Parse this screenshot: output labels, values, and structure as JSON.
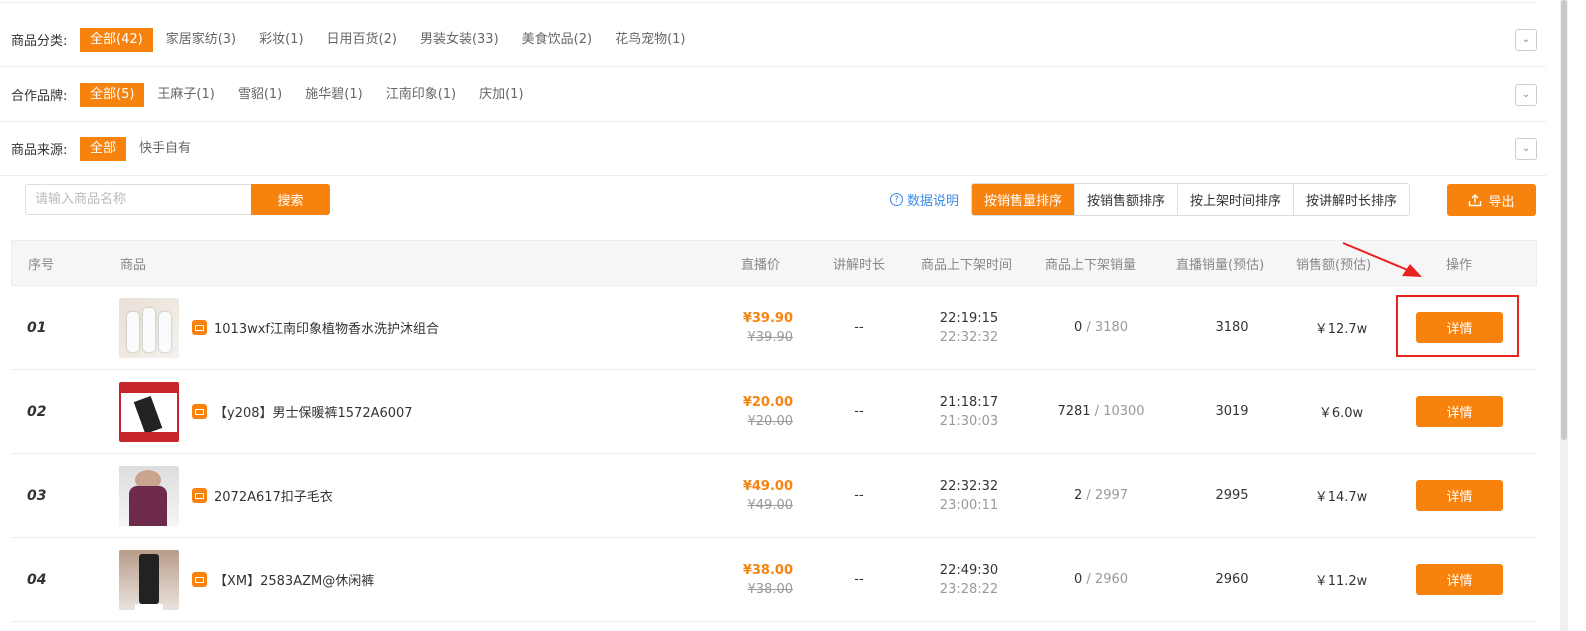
{
  "filters": {
    "category": {
      "label": "商品分类:",
      "options": [
        "全部(42)",
        "家居家纺(3)",
        "彩妆(1)",
        "日用百货(2)",
        "男装女装(33)",
        "美食饮品(2)",
        "花鸟宠物(1)"
      ],
      "active": 0
    },
    "brand": {
      "label": "合作品牌:",
      "options": [
        "全部(5)",
        "王麻子(1)",
        "雪貂(1)",
        "施华碧(1)",
        "江南印象(1)",
        "庆加(1)"
      ],
      "active": 0
    },
    "source": {
      "label": "商品来源:",
      "options": [
        "全部",
        "快手自有"
      ],
      "active": 0
    }
  },
  "search": {
    "placeholder": "请输入商品名称",
    "button": "搜索"
  },
  "data_note": "数据说明",
  "sort": [
    "按销售量排序",
    "按销售额排序",
    "按上架时间排序",
    "按讲解时长排序"
  ],
  "sort_active": 0,
  "export": "导出",
  "table": {
    "headers": {
      "seq": "序号",
      "product": "商品",
      "price": "直播价",
      "duration": "讲解时长",
      "shelf_time": "商品上下架时间",
      "shelf_sales": "商品上下架销量",
      "live_sales": "直播销量(预估)",
      "amount": "销售额(预估)",
      "action": "操作"
    },
    "rows": [
      {
        "seq": "01",
        "name": "1013wxf江南印象植物香水洗护沐组合",
        "price": "¥39.90",
        "orig_price": "¥39.90",
        "duration": "--",
        "on_time": "22:19:15",
        "off_time": "22:32:32",
        "sales_now": "0",
        "sales_total": "3180",
        "live_sales": "3180",
        "amount": "￥12.7w",
        "action": "详情"
      },
      {
        "seq": "02",
        "name": "【y208】男士保暖裤1572A6007",
        "price": "¥20.00",
        "orig_price": "¥20.00",
        "duration": "--",
        "on_time": "21:18:17",
        "off_time": "21:30:03",
        "sales_now": "7281",
        "sales_total": "10300",
        "live_sales": "3019",
        "amount": "￥6.0w",
        "action": "详情"
      },
      {
        "seq": "03",
        "name": "2072A617扣子毛衣",
        "price": "¥49.00",
        "orig_price": "¥49.00",
        "duration": "--",
        "on_time": "22:32:32",
        "off_time": "23:00:11",
        "sales_now": "2",
        "sales_total": "2997",
        "live_sales": "2995",
        "amount": "￥14.7w",
        "action": "详情"
      },
      {
        "seq": "04",
        "name": "【XM】2583AZM@休闲裤",
        "price": "¥38.00",
        "orig_price": "¥38.00",
        "duration": "--",
        "on_time": "22:49:30",
        "off_time": "23:28:22",
        "sales_now": "0",
        "sales_total": "2960",
        "live_sales": "2960",
        "amount": "￥11.2w",
        "action": "详情"
      }
    ]
  },
  "colors": {
    "accent": "#f7830e",
    "link": "#3c8be8",
    "highlight": "#e8221f"
  }
}
